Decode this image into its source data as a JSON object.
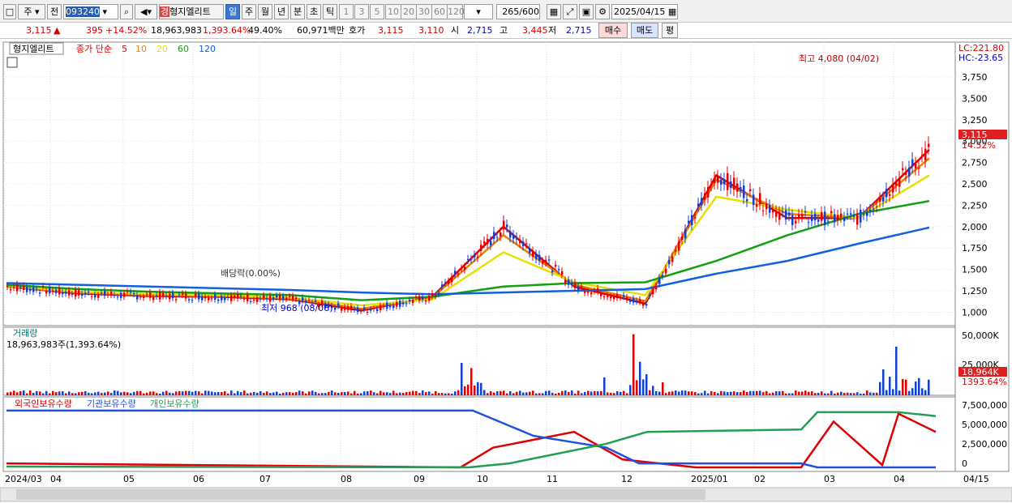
{
  "toolbar": {
    "market": "주",
    "prev": "전",
    "code": "093240",
    "name": "형지엘리트",
    "periods": [
      "일",
      "주",
      "월",
      "년",
      "분",
      "초",
      "틱"
    ],
    "selected_period": "일",
    "minutes": [
      "1",
      "3",
      "5",
      "10",
      "20",
      "30",
      "60",
      "120"
    ],
    "count": "265",
    "count_max": "/600",
    "date": "2025/04/15"
  },
  "info": {
    "price": "3,115",
    "arrow": "▲",
    "change": "395",
    "pct": "+14.52%",
    "volume": "18,963,983",
    "vol_pct": "1,393.64%",
    "turnover": "49.40%",
    "amount": "60,971백만",
    "hoga_label": "호가",
    "hoga1": "3,115",
    "hoga2": "3,110",
    "open_label": "시",
    "open": "2,715",
    "high_label": "고",
    "high": "3,445",
    "low_label": "저",
    "low": "2,715",
    "buy": "매수",
    "sell": "매도",
    "avg": "평"
  },
  "legend": {
    "name": "형지엘리트",
    "ma_label": "종가 단순",
    "ma": [
      {
        "p": "5",
        "c": "#e00000"
      },
      {
        "p": "10",
        "c": "#f08000"
      },
      {
        "p": "20",
        "c": "#e8e000"
      },
      {
        "p": "60",
        "c": "#10a010"
      },
      {
        "p": "120",
        "c": "#1060e0"
      }
    ]
  },
  "scale": {
    "lc": "LC:221.80",
    "hc": "HC:-23.65",
    "ticks": [
      "3,750",
      "3,500",
      "3,250",
      "3,000",
      "2,750",
      "2,500",
      "2,250",
      "2,000",
      "1,750",
      "1,500",
      "1,250",
      "1,000"
    ],
    "cur": "3,115",
    "cur_pct": "14.52%"
  },
  "annotations": {
    "high": "최고 4,080 (04/02)",
    "low": "최저 968 (08/06)",
    "div": "배당락(0.00%)"
  },
  "volume": {
    "title": "거래량",
    "value": "18,963,983주(1,393.64%)",
    "ticks": [
      "50,000K",
      "25,000K"
    ],
    "cur": "18,964K",
    "cur_pct": "1393.64%"
  },
  "holding": {
    "legend": [
      "외국인보유수량",
      "기관보유수량",
      "개인보유수량"
    ],
    "ticks": [
      "7,500,000",
      "5,000,000",
      "2,500,000",
      "0"
    ]
  },
  "xaxis": {
    "labels": [
      "2024/03",
      "04",
      "05",
      "06",
      "07",
      "08",
      "09",
      "10",
      "11",
      "12",
      "2025/01",
      "02",
      "03",
      "04",
      "04/15"
    ]
  },
  "chart_data": {
    "type": "line",
    "x": [
      "2024/03",
      "2024/04",
      "2024/05",
      "2024/06",
      "2024/07",
      "2024/08",
      "2024/09",
      "2024/10",
      "2024/11",
      "2024/12",
      "2025/01",
      "2025/02",
      "2025/03",
      "2025/04"
    ],
    "series": [
      {
        "name": "5",
        "values": [
          1300,
          1220,
          1190,
          1180,
          1150,
          1020,
          1180,
          2000,
          1300,
          1100,
          2600,
          2100,
          2100,
          2900
        ]
      },
      {
        "name": "10",
        "values": [
          1300,
          1230,
          1200,
          1190,
          1160,
          1040,
          1170,
          1900,
          1320,
          1130,
          2550,
          2150,
          2100,
          2800
        ]
      },
      {
        "name": "20",
        "values": [
          1310,
          1240,
          1210,
          1200,
          1170,
          1080,
          1150,
          1700,
          1350,
          1200,
          2350,
          2200,
          2100,
          2600
        ]
      },
      {
        "name": "60",
        "values": [
          1320,
          1270,
          1240,
          1220,
          1200,
          1140,
          1180,
          1300,
          1340,
          1350,
          1600,
          1900,
          2150,
          2300
        ]
      },
      {
        "name": "120",
        "values": [
          1340,
          1320,
          1300,
          1280,
          1260,
          1230,
          1210,
          1230,
          1250,
          1270,
          1450,
          1600,
          1800,
          1990
        ]
      }
    ],
    "ylim": [
      900,
      4100
    ]
  }
}
